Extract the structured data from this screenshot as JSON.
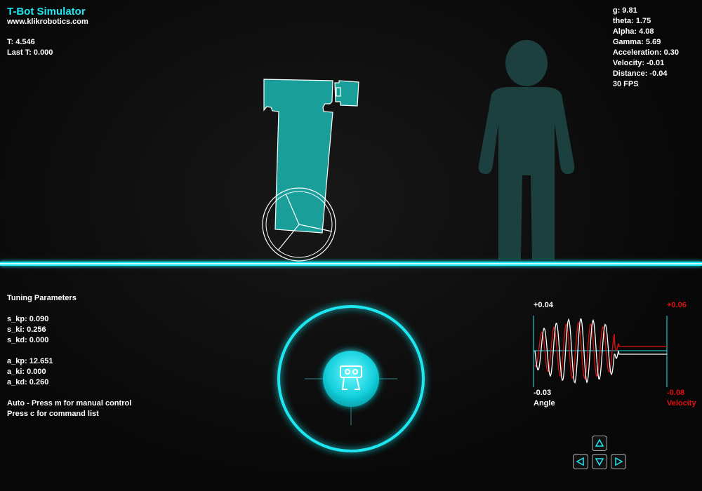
{
  "app": {
    "title": "T-Bot Simulator",
    "subtitle": "www.klikrobotics.com"
  },
  "timing": {
    "t": "T: 4.546",
    "last_t": "Last T: 0.000"
  },
  "stats": [
    "g: 9.81",
    "theta: 1.75",
    "Alpha: 4.08",
    "Gamma: 5.69",
    "Acceleration: 0.30",
    "Velocity: -0.01",
    "Distance: -0.04",
    "30 FPS"
  ],
  "tuning": {
    "heading": "Tuning Parameters",
    "speed": [
      "s_kp: 0.090",
      "s_ki: 0.256",
      "s_kd: 0.000"
    ],
    "angle": [
      "a_kp: 12.651",
      "a_ki: 0.000",
      "a_kd: 0.260"
    ],
    "mode": "Auto - Press m for manual control",
    "commands": "Press c for command list"
  },
  "graph": {
    "angle_max": "+0.04",
    "angle_min": "-0.03",
    "angle_label": "Angle",
    "velocity_max": "+0.06",
    "velocity_min": "-0.08",
    "velocity_label": "Velocity",
    "angle_color": "#ffffff",
    "velocity_color": "#e01010"
  },
  "colors": {
    "accent": "#1fe6f0",
    "robot_body": "#1a9e9a",
    "human_silhouette": "#1f4948"
  },
  "joystick": {
    "center_icon": "robot-icon"
  },
  "dpad": {
    "up_icon": "triangle-up-icon",
    "left_icon": "triangle-left-icon",
    "down_icon": "triangle-down-icon",
    "right_icon": "triangle-right-icon"
  }
}
